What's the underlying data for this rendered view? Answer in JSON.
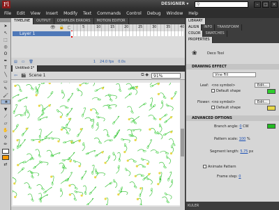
{
  "app": {
    "logo": "Fl",
    "workspace": "DESIGNER ▾",
    "window_buttons": [
      "–",
      "□",
      "×"
    ]
  },
  "menu": [
    "File",
    "Edit",
    "View",
    "Insert",
    "Modify",
    "Text",
    "Commands",
    "Control",
    "Debug",
    "Window",
    "Help"
  ],
  "timeline": {
    "tabs": [
      "TIMELINE",
      "OUTPUT",
      "COMPILER ERRORS",
      "MOTION EDITOR"
    ],
    "frame_numbers": [
      "5",
      "10",
      "15",
      "20",
      "25",
      "30",
      "35",
      "40"
    ],
    "layer_name": "Layer 1",
    "footer": {
      "frame": "1",
      "fps": "24.0 fps",
      "time": "0.0s"
    }
  },
  "document": {
    "tab": "Untitled-1*",
    "scene": "Scene 1",
    "zoom": "91%"
  },
  "panels": {
    "top_tabs": [
      "LIBRARY"
    ],
    "second_tabs": [
      "ALIGN",
      "INFO",
      "TRANSFORM"
    ],
    "third_tabs": [
      "COLOR",
      "SWATCHES"
    ],
    "properties_tab": "PROPERTIES",
    "tool_name": "Deco Tool",
    "drawing_effect": {
      "header": "DRAWING EFFECT",
      "fill": "Vine Fill",
      "leaf_label": "Leaf:",
      "leaf_symbol": "<no symbol>",
      "flower_label": "Flower:",
      "flower_symbol": "<no symbol>",
      "edit": "Edit...",
      "default_shape": "Default shape"
    },
    "advanced": {
      "header": "ADVANCED OPTIONS",
      "branch_angle_label": "Branch angle:",
      "branch_angle_value": "0",
      "branch_angle_unit": "CW",
      "pattern_scale_label": "Pattern scale:",
      "pattern_scale_value": "100",
      "pattern_scale_unit": "%",
      "segment_length_label": "Segment length:",
      "segment_length_value": "5.75",
      "segment_length_unit": "px",
      "animate_pattern": "Animate Pattern",
      "frame_step_label": "Frame step:",
      "frame_step_value": "0"
    },
    "kuler": "KULER"
  },
  "colors": {
    "leaf": "#2ecc2e",
    "flower": "#e8d84a",
    "branch": "#22bb22",
    "layer": "#4e78b8",
    "accent": "#1a4fb5"
  },
  "tools": [
    "selection-tool",
    "subselection-tool",
    "free-transform-tool",
    "3d-rotation-tool",
    "lasso-tool",
    "pen-tool",
    "text-tool",
    "line-tool",
    "rectangle-tool",
    "pencil-tool",
    "brush-tool",
    "deco-tool",
    "bone-tool",
    "paint-bucket-tool",
    "eyedropper-tool",
    "eraser-tool",
    "hand-tool",
    "zoom-tool"
  ]
}
